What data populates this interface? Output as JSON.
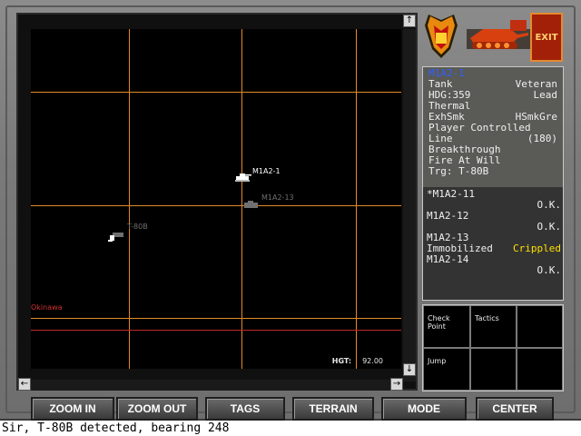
{
  "map": {
    "region_label": "Okinawa",
    "hgt_label": "HGT:",
    "hgt_value": "92.00",
    "units": [
      {
        "label": "M1A2-1",
        "color": "#ffffff"
      },
      {
        "label": "M1A2-13",
        "color": "#707070"
      },
      {
        "label": "T-80B",
        "color": "#707070"
      }
    ]
  },
  "scroll": {
    "up": "↑",
    "down": "↓",
    "left": "←",
    "right": "→"
  },
  "exit_label": "EXIT",
  "unit_detail": {
    "name": "M1A2-1",
    "type": "Tank",
    "experience": "Veteran",
    "heading": "HDG:359",
    "role": "Lead",
    "sight": "Thermal",
    "ammo_left": "ExhSmk",
    "ammo_right": "HSmkGre",
    "control": "Player Controlled",
    "formation": "Line",
    "formation_value": "(180)",
    "tactic": "Breakthrough",
    "fire_order": "Fire At Will",
    "target": "Trg: T-80B"
  },
  "squad": [
    {
      "name": "*M1A2-11",
      "status": "O.K.",
      "condition": ""
    },
    {
      "name": "M1A2-12",
      "status": "O.K.",
      "condition": ""
    },
    {
      "name": "M1A2-13",
      "status": "Crippled",
      "condition": "Immobilized"
    },
    {
      "name": "M1A2-14",
      "status": "O.K.",
      "condition": ""
    }
  ],
  "commands": [
    "Check Point",
    "Tactics",
    "",
    "Jump",
    "",
    ""
  ],
  "buttons": [
    "ZOOM IN",
    "ZOOM OUT",
    "TAGS",
    "TERRAIN",
    "MODE",
    "CENTER"
  ],
  "message": "Sir, T-80B detected, bearing 248",
  "colors": {
    "grid": "#e38a2a",
    "region_line": "#c0282a",
    "crippled": "#ffe000",
    "title": "#3060ff"
  }
}
